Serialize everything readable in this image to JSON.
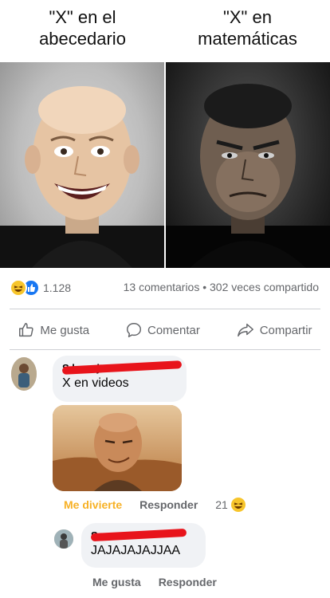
{
  "meme": {
    "left_caption": "\"X\" en el\nabecedario",
    "right_caption": "\"X\" en\nmatemáticas"
  },
  "stats": {
    "reaction_count": "1.128",
    "comments_shares": "13 comentarios • 302 veces compartido",
    "reaction_icons": [
      "haha-emoji-icon",
      "like-thumb-icon"
    ]
  },
  "actions": {
    "like": "Me gusta",
    "comment": "Comentar",
    "share": "Compartir"
  },
  "comments": [
    {
      "author_visible": "S          lnarejo",
      "text": "X en videos",
      "has_media": true,
      "actions": {
        "reaction_label": "Me divierte",
        "reply": "Responder",
        "count": "21"
      }
    },
    {
      "author_visible": "S",
      "text": "JAJAJAJAJJAA",
      "actions": {
        "like": "Me gusta",
        "reply": "Responder"
      }
    }
  ],
  "colors": {
    "accent_blue": "#1877f2",
    "haha_yellow": "#f7b125",
    "redaction_red": "#e8141b",
    "muted_text": "#65676b"
  }
}
